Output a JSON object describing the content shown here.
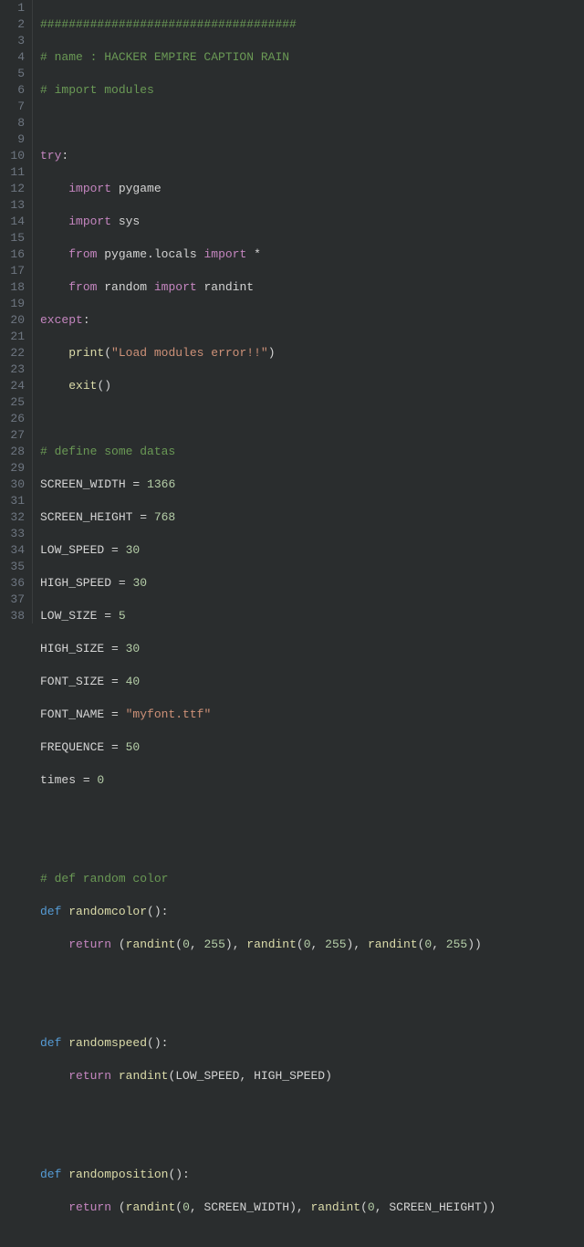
{
  "editor": {
    "line_count": 38,
    "gutter": [
      "1",
      "2",
      "3",
      "4",
      "5",
      "6",
      "7",
      "8",
      "9",
      "10",
      "11",
      "12",
      "13",
      "14",
      "15",
      "16",
      "17",
      "18",
      "19",
      "20",
      "21",
      "22",
      "23",
      "24",
      "25",
      "26",
      "27",
      "28",
      "29",
      "30",
      "31",
      "32",
      "33",
      "34",
      "35",
      "36",
      "37",
      "38"
    ]
  },
  "code": {
    "l1": {
      "c1": "####################################"
    },
    "l2": {
      "c1": "# name : HACKER EMPIRE CAPTION RAIN"
    },
    "l3": {
      "c1": "# import modules"
    },
    "l5": {
      "k1": "try",
      "p1": ":"
    },
    "l6": {
      "k1": "import",
      "id1": " pygame"
    },
    "l7": {
      "k1": "import",
      "id1": " sys"
    },
    "l8": {
      "k1": "from",
      "id1": " pygame.locals ",
      "k2": "import",
      "id2": " ",
      "star": "*"
    },
    "l9": {
      "k1": "from",
      "id1": " random ",
      "k2": "import",
      "id2": " randint"
    },
    "l10": {
      "k1": "except",
      "p1": ":"
    },
    "l11": {
      "fn": "print",
      "p1": "(",
      "s1": "\"Load modules error!!\"",
      "p2": ")"
    },
    "l12": {
      "fn": "exit",
      "p1": "()"
    },
    "l14": {
      "c1": "# define some datas"
    },
    "l15": {
      "id1": "SCREEN_WIDTH ",
      "op": "=",
      "n1": " 1366"
    },
    "l16": {
      "id1": "SCREEN_HEIGHT ",
      "op": "=",
      "n1": " 768"
    },
    "l17": {
      "id1": "LOW_SPEED ",
      "op": "=",
      "n1": " 30"
    },
    "l18": {
      "id1": "HIGH_SPEED ",
      "op": "=",
      "n1": " 30"
    },
    "l19": {
      "id1": "LOW_SIZE ",
      "op": "=",
      "n1": " 5"
    },
    "l20": {
      "id1": "HIGH_SIZE ",
      "op": "=",
      "n1": " 30"
    },
    "l21": {
      "id1": "FONT_SIZE ",
      "op": "=",
      "n1": " 40"
    },
    "l22": {
      "id1": "FONT_NAME ",
      "op": "=",
      "s1": " \"myfont.ttf\""
    },
    "l23": {
      "id1": "FREQUENCE ",
      "op": "=",
      "n1": " 50"
    },
    "l24": {
      "id1": "times ",
      "op": "=",
      "n1": " 0"
    },
    "l27": {
      "c1": "# def random color"
    },
    "l28": {
      "k1": "def",
      "sp": " ",
      "fn": "randomcolor",
      "p1": "():"
    },
    "l29": {
      "k1": "return",
      "p1": " (",
      "fn1": "randint",
      "p2": "(",
      "n1": "0",
      "p3": ", ",
      "n2": "255",
      "p4": "), ",
      "fn2": "randint",
      "p5": "(",
      "n3": "0",
      "p6": ", ",
      "n4": "255",
      "p7": "), ",
      "fn3": "randint",
      "p8": "(",
      "n5": "0",
      "p9": ", ",
      "n6": "255",
      "p10": "))"
    },
    "l32": {
      "k1": "def",
      "sp": " ",
      "fn": "randomspeed",
      "p1": "():"
    },
    "l33": {
      "k1": "return",
      "sp": " ",
      "fn": "randint",
      "p1": "(LOW_SPEED, HIGH_SPEED)"
    },
    "l36": {
      "k1": "def",
      "sp": " ",
      "fn": "randomposition",
      "p1": "():"
    },
    "l37": {
      "k1": "return",
      "p1": " (",
      "fn1": "randint",
      "p2": "(",
      "n1": "0",
      "p3": ", SCREEN_WIDTH), ",
      "fn2": "randint",
      "p4": "(",
      "n2": "0",
      "p5": ", SCREEN_HEIGHT))"
    }
  },
  "chart_data": null
}
